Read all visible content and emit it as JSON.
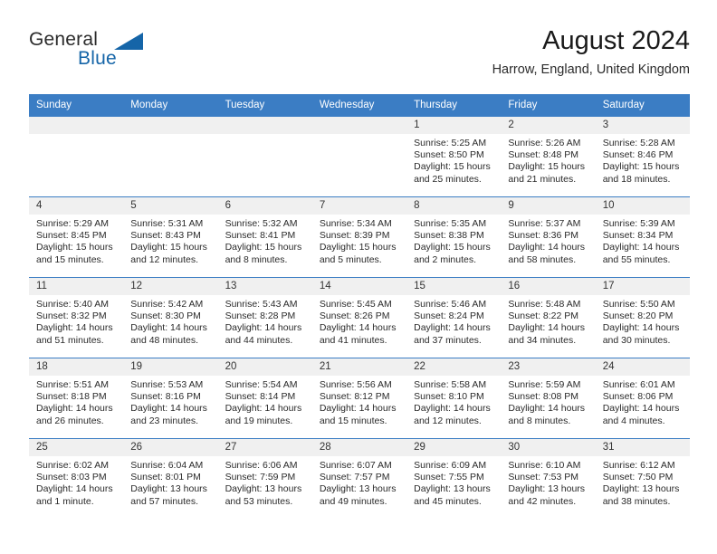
{
  "brand": {
    "name_top": "General",
    "name_bottom": "Blue",
    "accent_color": "#1565a8"
  },
  "header": {
    "title": "August 2024",
    "location": "Harrow, England, United Kingdom"
  },
  "theme": {
    "header_bar_color": "#3b7dc4",
    "daynum_band_color": "#f0f0f0",
    "text_color": "#2a2a2a"
  },
  "weekday_headers": [
    "Sunday",
    "Monday",
    "Tuesday",
    "Wednesday",
    "Thursday",
    "Friday",
    "Saturday"
  ],
  "weeks": [
    [
      {
        "day": "",
        "sunrise": "",
        "sunset": "",
        "daylight_a": "",
        "daylight_b": ""
      },
      {
        "day": "",
        "sunrise": "",
        "sunset": "",
        "daylight_a": "",
        "daylight_b": ""
      },
      {
        "day": "",
        "sunrise": "",
        "sunset": "",
        "daylight_a": "",
        "daylight_b": ""
      },
      {
        "day": "",
        "sunrise": "",
        "sunset": "",
        "daylight_a": "",
        "daylight_b": ""
      },
      {
        "day": "1",
        "sunrise": "Sunrise: 5:25 AM",
        "sunset": "Sunset: 8:50 PM",
        "daylight_a": "Daylight: 15 hours",
        "daylight_b": "and 25 minutes."
      },
      {
        "day": "2",
        "sunrise": "Sunrise: 5:26 AM",
        "sunset": "Sunset: 8:48 PM",
        "daylight_a": "Daylight: 15 hours",
        "daylight_b": "and 21 minutes."
      },
      {
        "day": "3",
        "sunrise": "Sunrise: 5:28 AM",
        "sunset": "Sunset: 8:46 PM",
        "daylight_a": "Daylight: 15 hours",
        "daylight_b": "and 18 minutes."
      }
    ],
    [
      {
        "day": "4",
        "sunrise": "Sunrise: 5:29 AM",
        "sunset": "Sunset: 8:45 PM",
        "daylight_a": "Daylight: 15 hours",
        "daylight_b": "and 15 minutes."
      },
      {
        "day": "5",
        "sunrise": "Sunrise: 5:31 AM",
        "sunset": "Sunset: 8:43 PM",
        "daylight_a": "Daylight: 15 hours",
        "daylight_b": "and 12 minutes."
      },
      {
        "day": "6",
        "sunrise": "Sunrise: 5:32 AM",
        "sunset": "Sunset: 8:41 PM",
        "daylight_a": "Daylight: 15 hours",
        "daylight_b": "and 8 minutes."
      },
      {
        "day": "7",
        "sunrise": "Sunrise: 5:34 AM",
        "sunset": "Sunset: 8:39 PM",
        "daylight_a": "Daylight: 15 hours",
        "daylight_b": "and 5 minutes."
      },
      {
        "day": "8",
        "sunrise": "Sunrise: 5:35 AM",
        "sunset": "Sunset: 8:38 PM",
        "daylight_a": "Daylight: 15 hours",
        "daylight_b": "and 2 minutes."
      },
      {
        "day": "9",
        "sunrise": "Sunrise: 5:37 AM",
        "sunset": "Sunset: 8:36 PM",
        "daylight_a": "Daylight: 14 hours",
        "daylight_b": "and 58 minutes."
      },
      {
        "day": "10",
        "sunrise": "Sunrise: 5:39 AM",
        "sunset": "Sunset: 8:34 PM",
        "daylight_a": "Daylight: 14 hours",
        "daylight_b": "and 55 minutes."
      }
    ],
    [
      {
        "day": "11",
        "sunrise": "Sunrise: 5:40 AM",
        "sunset": "Sunset: 8:32 PM",
        "daylight_a": "Daylight: 14 hours",
        "daylight_b": "and 51 minutes."
      },
      {
        "day": "12",
        "sunrise": "Sunrise: 5:42 AM",
        "sunset": "Sunset: 8:30 PM",
        "daylight_a": "Daylight: 14 hours",
        "daylight_b": "and 48 minutes."
      },
      {
        "day": "13",
        "sunrise": "Sunrise: 5:43 AM",
        "sunset": "Sunset: 8:28 PM",
        "daylight_a": "Daylight: 14 hours",
        "daylight_b": "and 44 minutes."
      },
      {
        "day": "14",
        "sunrise": "Sunrise: 5:45 AM",
        "sunset": "Sunset: 8:26 PM",
        "daylight_a": "Daylight: 14 hours",
        "daylight_b": "and 41 minutes."
      },
      {
        "day": "15",
        "sunrise": "Sunrise: 5:46 AM",
        "sunset": "Sunset: 8:24 PM",
        "daylight_a": "Daylight: 14 hours",
        "daylight_b": "and 37 minutes."
      },
      {
        "day": "16",
        "sunrise": "Sunrise: 5:48 AM",
        "sunset": "Sunset: 8:22 PM",
        "daylight_a": "Daylight: 14 hours",
        "daylight_b": "and 34 minutes."
      },
      {
        "day": "17",
        "sunrise": "Sunrise: 5:50 AM",
        "sunset": "Sunset: 8:20 PM",
        "daylight_a": "Daylight: 14 hours",
        "daylight_b": "and 30 minutes."
      }
    ],
    [
      {
        "day": "18",
        "sunrise": "Sunrise: 5:51 AM",
        "sunset": "Sunset: 8:18 PM",
        "daylight_a": "Daylight: 14 hours",
        "daylight_b": "and 26 minutes."
      },
      {
        "day": "19",
        "sunrise": "Sunrise: 5:53 AM",
        "sunset": "Sunset: 8:16 PM",
        "daylight_a": "Daylight: 14 hours",
        "daylight_b": "and 23 minutes."
      },
      {
        "day": "20",
        "sunrise": "Sunrise: 5:54 AM",
        "sunset": "Sunset: 8:14 PM",
        "daylight_a": "Daylight: 14 hours",
        "daylight_b": "and 19 minutes."
      },
      {
        "day": "21",
        "sunrise": "Sunrise: 5:56 AM",
        "sunset": "Sunset: 8:12 PM",
        "daylight_a": "Daylight: 14 hours",
        "daylight_b": "and 15 minutes."
      },
      {
        "day": "22",
        "sunrise": "Sunrise: 5:58 AM",
        "sunset": "Sunset: 8:10 PM",
        "daylight_a": "Daylight: 14 hours",
        "daylight_b": "and 12 minutes."
      },
      {
        "day": "23",
        "sunrise": "Sunrise: 5:59 AM",
        "sunset": "Sunset: 8:08 PM",
        "daylight_a": "Daylight: 14 hours",
        "daylight_b": "and 8 minutes."
      },
      {
        "day": "24",
        "sunrise": "Sunrise: 6:01 AM",
        "sunset": "Sunset: 8:06 PM",
        "daylight_a": "Daylight: 14 hours",
        "daylight_b": "and 4 minutes."
      }
    ],
    [
      {
        "day": "25",
        "sunrise": "Sunrise: 6:02 AM",
        "sunset": "Sunset: 8:03 PM",
        "daylight_a": "Daylight: 14 hours",
        "daylight_b": "and 1 minute."
      },
      {
        "day": "26",
        "sunrise": "Sunrise: 6:04 AM",
        "sunset": "Sunset: 8:01 PM",
        "daylight_a": "Daylight: 13 hours",
        "daylight_b": "and 57 minutes."
      },
      {
        "day": "27",
        "sunrise": "Sunrise: 6:06 AM",
        "sunset": "Sunset: 7:59 PM",
        "daylight_a": "Daylight: 13 hours",
        "daylight_b": "and 53 minutes."
      },
      {
        "day": "28",
        "sunrise": "Sunrise: 6:07 AM",
        "sunset": "Sunset: 7:57 PM",
        "daylight_a": "Daylight: 13 hours",
        "daylight_b": "and 49 minutes."
      },
      {
        "day": "29",
        "sunrise": "Sunrise: 6:09 AM",
        "sunset": "Sunset: 7:55 PM",
        "daylight_a": "Daylight: 13 hours",
        "daylight_b": "and 45 minutes."
      },
      {
        "day": "30",
        "sunrise": "Sunrise: 6:10 AM",
        "sunset": "Sunset: 7:53 PM",
        "daylight_a": "Daylight: 13 hours",
        "daylight_b": "and 42 minutes."
      },
      {
        "day": "31",
        "sunrise": "Sunrise: 6:12 AM",
        "sunset": "Sunset: 7:50 PM",
        "daylight_a": "Daylight: 13 hours",
        "daylight_b": "and 38 minutes."
      }
    ]
  ]
}
